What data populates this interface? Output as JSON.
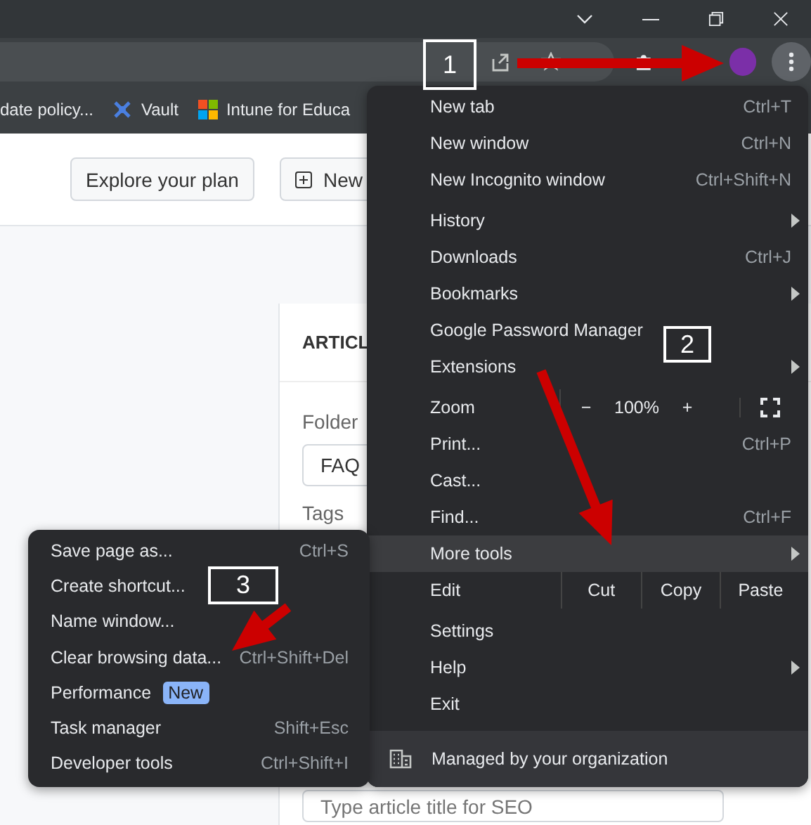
{
  "bookmarks": [
    {
      "label": "date policy..."
    },
    {
      "label": "Vault"
    },
    {
      "label": "Intune for Educa"
    }
  ],
  "page": {
    "buttons": [
      {
        "label": "Explore your plan"
      },
      {
        "label": "New"
      }
    ],
    "card_title": "ARTICL",
    "folder_label": "Folder",
    "folder_value": "FAQ",
    "tags_label": "Tags",
    "seo_placeholder": "Type article title for SEO"
  },
  "menu": {
    "items": [
      {
        "kind": "item",
        "label": "New tab",
        "shortcut": "Ctrl+T",
        "submenu": false,
        "selected": false
      },
      {
        "kind": "item",
        "label": "New window",
        "shortcut": "Ctrl+N",
        "submenu": false,
        "selected": false
      },
      {
        "kind": "item",
        "label": "New Incognito window",
        "shortcut": "Ctrl+Shift+N",
        "submenu": false,
        "selected": false
      },
      {
        "kind": "separator"
      },
      {
        "kind": "item",
        "label": "History",
        "submenu": true,
        "selected": false
      },
      {
        "kind": "item",
        "label": "Downloads",
        "shortcut": "Ctrl+J",
        "submenu": false,
        "selected": false
      },
      {
        "kind": "item",
        "label": "Bookmarks",
        "submenu": true,
        "selected": false
      },
      {
        "kind": "item",
        "label": "Google Password Manager",
        "submenu": false,
        "selected": false
      },
      {
        "kind": "item",
        "label": "Extensions",
        "submenu": true,
        "selected": false
      },
      {
        "kind": "separator"
      },
      {
        "kind": "zoom",
        "label": "Zoom",
        "minus": "−",
        "value": "100%",
        "plus": "+"
      },
      {
        "kind": "item",
        "label": "Print...",
        "shortcut": "Ctrl+P",
        "submenu": false,
        "selected": false
      },
      {
        "kind": "item",
        "label": "Cast...",
        "submenu": false,
        "selected": false
      },
      {
        "kind": "item",
        "label": "Find...",
        "shortcut": "Ctrl+F",
        "submenu": false,
        "selected": false
      },
      {
        "kind": "item",
        "label": "More tools",
        "submenu": true,
        "selected": true
      },
      {
        "kind": "edit",
        "label": "Edit",
        "actions": [
          "Cut",
          "Copy",
          "Paste"
        ]
      },
      {
        "kind": "separator"
      },
      {
        "kind": "item",
        "label": "Settings",
        "submenu": false,
        "selected": false
      },
      {
        "kind": "item",
        "label": "Help",
        "submenu": true,
        "selected": false
      },
      {
        "kind": "item",
        "label": "Exit",
        "submenu": false,
        "selected": false
      }
    ],
    "footer": "Managed by your organization"
  },
  "submenu": {
    "items": [
      {
        "label": "Save page as...",
        "shortcut": "Ctrl+S"
      },
      {
        "label": "Create shortcut..."
      },
      {
        "label": "Name window..."
      },
      {
        "label": "Clear browsing data...",
        "shortcut": "Ctrl+Shift+Del"
      },
      {
        "label": "Performance",
        "badge": "New"
      },
      {
        "label": "Task manager",
        "shortcut": "Shift+Esc"
      },
      {
        "label": "Developer tools",
        "shortcut": "Ctrl+Shift+I"
      }
    ]
  },
  "annotations": [
    {
      "label": "1"
    },
    {
      "label": "2"
    },
    {
      "label": "3"
    }
  ]
}
